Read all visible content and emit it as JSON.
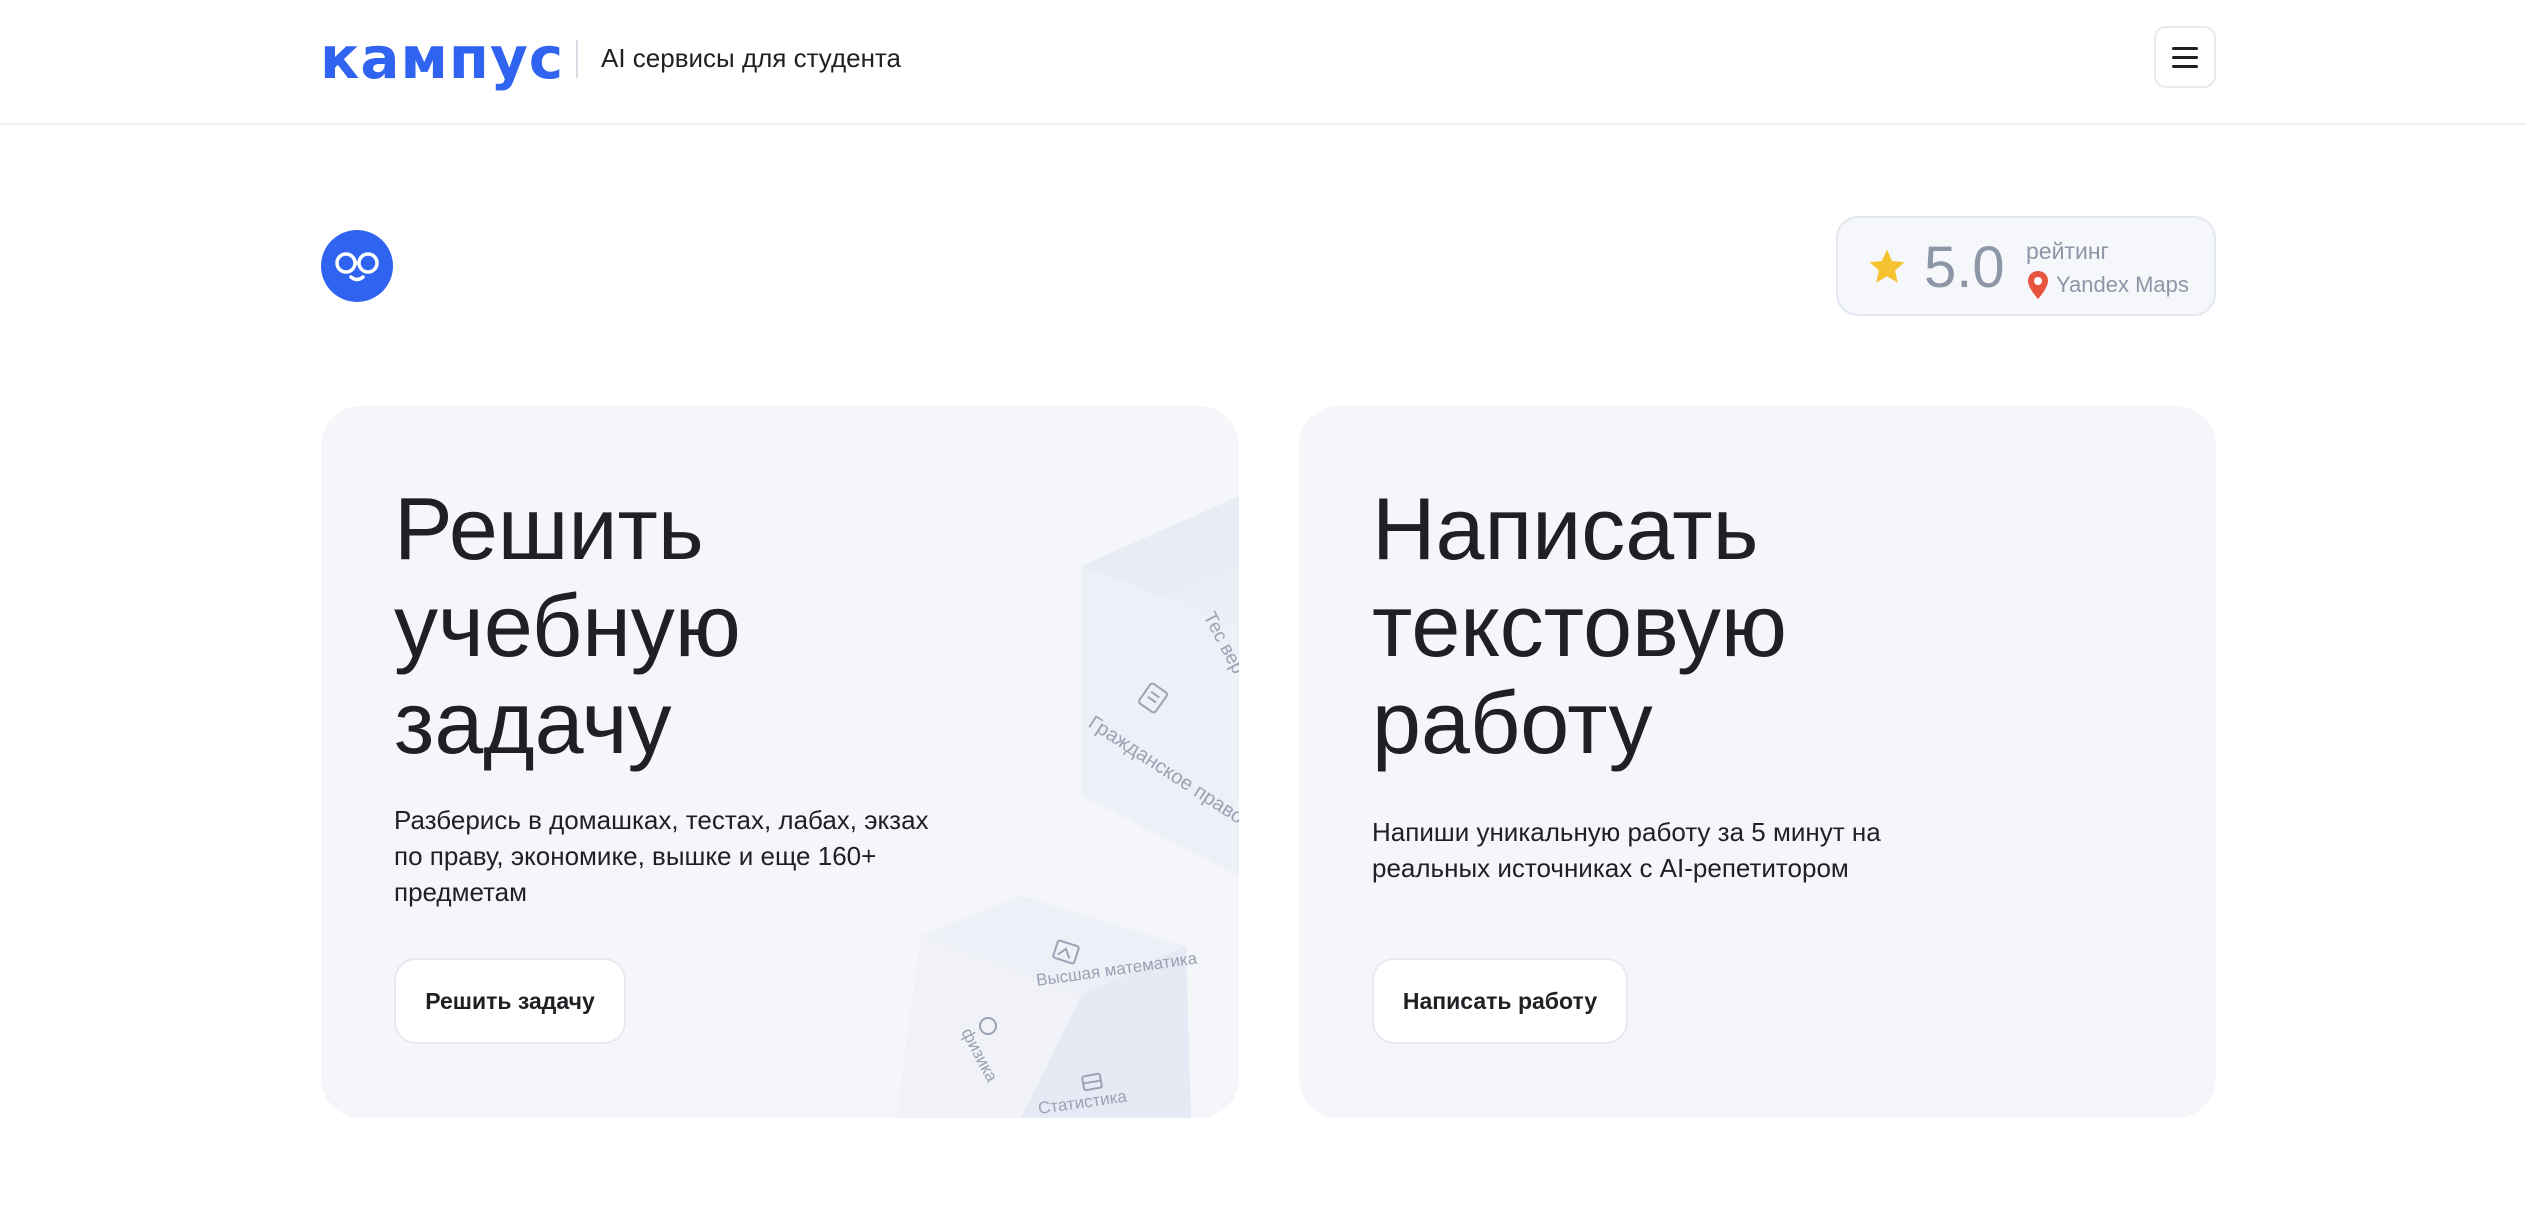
{
  "header": {
    "logo_text": "кампус",
    "tagline": "AI сервисы для студента",
    "menu_icon": "hamburger-icon"
  },
  "mascot": {
    "icon": "mascot-face-icon",
    "color": "#2f63f0"
  },
  "rating": {
    "value": "5.0",
    "label": "рейтинг",
    "source": "Yandex Maps",
    "star_color": "#f5c330",
    "pin_color": "#e8533f"
  },
  "cards": [
    {
      "title_lines": [
        "Решить",
        "учебную",
        "задачу"
      ],
      "description": "Разберись в домашках, тестах, лабах, экзах по праву, экономике, вышке и еще 160+ предметам",
      "button_label": "Решить задачу",
      "cube_labels": {
        "top_cube_face1": "Тес вер",
        "top_cube_face2": "Гражданское право",
        "bottom_cube_top": "Высшая математика",
        "bottom_cube_left": "физика",
        "bottom_cube_front": "Статистика"
      }
    },
    {
      "title_lines": [
        "Написать",
        "текстовую",
        "работу"
      ],
      "description": "Напиши уникальную работу за 5 минут на реальных источниках с AI-репетитором",
      "button_label": "Написать работу"
    }
  ],
  "colors": {
    "brand": "#2f63f0",
    "card_bg": "#f5f6fa",
    "text": "#1f1f24",
    "muted": "#8d96a6"
  }
}
